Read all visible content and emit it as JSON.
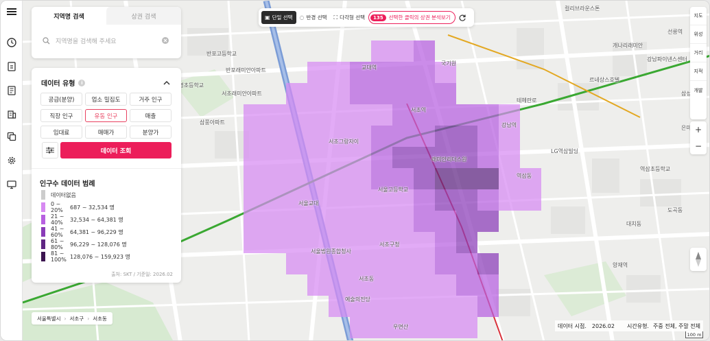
{
  "colors": {
    "accent": "#ec1e5a",
    "legend_none": "#cccccc",
    "legend_1": "#d78af2",
    "legend_2": "#b760e0",
    "legend_3": "#8a3cb8",
    "legend_4": "#5f2683",
    "legend_5": "#3c1550"
  },
  "sidebar": {
    "icons": [
      "menu-icon",
      "clock-icon",
      "report-icon",
      "document-icon",
      "building-icon",
      "copy-icon",
      "settings-icon",
      "monitor-icon"
    ]
  },
  "search": {
    "tabs": [
      {
        "label": "지역명 검색",
        "active": true
      },
      {
        "label": "상권 검색",
        "active": false
      }
    ],
    "placeholder": "지역명을 검색해 주세요"
  },
  "data_type": {
    "title": "데이터 유형",
    "options": [
      {
        "label": "공급(분양)",
        "selected": false
      },
      {
        "label": "업소 밀집도",
        "selected": false
      },
      {
        "label": "거주 인구",
        "selected": false
      },
      {
        "label": "직장 인구",
        "selected": false
      },
      {
        "label": "유동 인구",
        "selected": true
      },
      {
        "label": "매출",
        "selected": false
      },
      {
        "label": "임대료",
        "selected": false
      },
      {
        "label": "매매가",
        "selected": false
      },
      {
        "label": "분양가",
        "selected": false
      }
    ],
    "query_button": "데이터 조회"
  },
  "legend": {
    "title": "인구수 데이터 범례",
    "rows": [
      {
        "range": "데이터없음",
        "value": ""
      },
      {
        "range": "0 ~ 20%",
        "value": "687 ~ 32,534 명"
      },
      {
        "range": "21 ~ 40%",
        "value": "32,534 ~ 64,381 명"
      },
      {
        "range": "41 ~ 60%",
        "value": "64,381 ~ 96,229 명"
      },
      {
        "range": "61 ~ 80%",
        "value": "96,229 ~ 128,076 명"
      },
      {
        "range": "81 ~ 100%",
        "value": "128,076 ~ 159,923 명"
      }
    ],
    "source": "출처: SKT / 기준일: 2026.02"
  },
  "toolbar": {
    "single": "단일 선택",
    "radius": "반경 선택",
    "polygon": "다각형 선택",
    "selected_count": "135",
    "analyze": "선택한 클릭의 상권 분석보기"
  },
  "right_rail": {
    "items": [
      "지도",
      "위성",
      "거리",
      "지적",
      "개발"
    ],
    "zoom_in": "+",
    "zoom_out": "−"
  },
  "breadcrumb": [
    "서울특별시",
    "서초구",
    "서초동"
  ],
  "footer": {
    "date_label": "데이터 시점.",
    "date_value": "2026.02",
    "time_label": "시간유형.",
    "time_value": "주중 전체, 주말 전체"
  },
  "scale": "100 m",
  "map_labels": [
    "컬리브라운스톤",
    "반포고등학교",
    "반포래미안아파트",
    "서초래미안아파트",
    "원명초등학교",
    "삼풍아파트",
    "서초그랑자이",
    "강남역",
    "교대역",
    "서초역",
    "서울고등학교",
    "서울교대",
    "래미안리더스원",
    "서초동",
    "우면산",
    "역삼동",
    "르네상스호텔",
    "LG역삼빌딩",
    "개나리래미안",
    "역삼초등학교",
    "강남파이낸스센터",
    "서초구청",
    "양재역",
    "테헤란로",
    "도곡동",
    "은마아파트",
    "대치동",
    "선릉역",
    "삼성동",
    "국기원",
    "서울법원종합청사",
    "예술의전당"
  ]
}
